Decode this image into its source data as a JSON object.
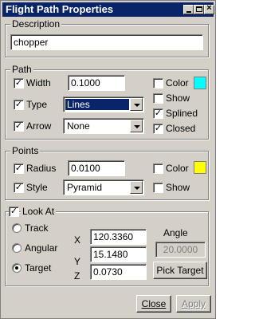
{
  "window": {
    "title": "Flight Path Properties"
  },
  "description": {
    "legend": "Description",
    "value": "chopper"
  },
  "path": {
    "legend": "Path",
    "width": {
      "label": "Width",
      "checked": true,
      "value": "0.1000"
    },
    "type": {
      "label": "Type",
      "checked": true,
      "value": "Lines"
    },
    "arrow": {
      "label": "Arrow",
      "checked": true,
      "value": "None"
    },
    "color": {
      "label": "Color",
      "checked": false,
      "swatch": "#00ffff"
    },
    "show": {
      "label": "Show",
      "checked": false
    },
    "splined": {
      "label": "Splined",
      "checked": true
    },
    "closed": {
      "label": "Closed",
      "checked": true
    }
  },
  "points": {
    "legend": "Points",
    "radius": {
      "label": "Radius",
      "checked": true,
      "value": "0.0100"
    },
    "style": {
      "label": "Style",
      "checked": true,
      "value": "Pyramid"
    },
    "color": {
      "label": "Color",
      "checked": false,
      "swatch": "#ffff00"
    },
    "show": {
      "label": "Show",
      "checked": false
    }
  },
  "look_at": {
    "legend": "Look At",
    "checked": true,
    "modes": [
      {
        "label": "Track",
        "selected": false
      },
      {
        "label": "Angular",
        "selected": false
      },
      {
        "label": "Target",
        "selected": true
      }
    ],
    "axes": [
      "X",
      "Y",
      "Z"
    ],
    "x": "120.3360",
    "y": "15.1480",
    "z": "0.0730",
    "angle_label": "Angle",
    "angle_value": "20.0000",
    "pick_target": "Pick Target"
  },
  "buttons": {
    "close": "Close",
    "apply": "Apply"
  },
  "checkmark": "✓"
}
